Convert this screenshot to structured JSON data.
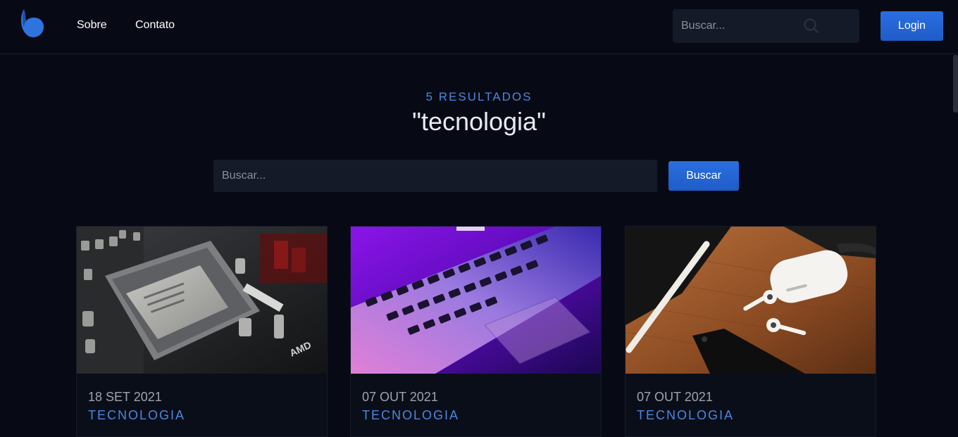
{
  "header": {
    "nav": [
      {
        "label": "Sobre"
      },
      {
        "label": "Contato"
      }
    ],
    "search": {
      "placeholder": "Buscar..."
    },
    "login_label": "Login"
  },
  "results": {
    "count_label": "5 RESULTADOS",
    "query": "\"tecnologia\""
  },
  "search_bar": {
    "placeholder": "Buscar...",
    "button_label": "Buscar"
  },
  "cards": [
    {
      "date": "18 SET 2021",
      "category": "TECNOLOGIA",
      "image": "cpu-motherboard-photo"
    },
    {
      "date": "07 OUT 2021",
      "category": "TECNOLOGIA",
      "image": "laptop-keyboard-photo"
    },
    {
      "date": "07 OUT 2021",
      "category": "TECNOLOGIA",
      "image": "airpods-pencil-phone-photo"
    }
  ],
  "colors": {
    "background": "#070a14",
    "accent": "#4b87e0",
    "button": "#2566d6",
    "input": "#141a27"
  }
}
